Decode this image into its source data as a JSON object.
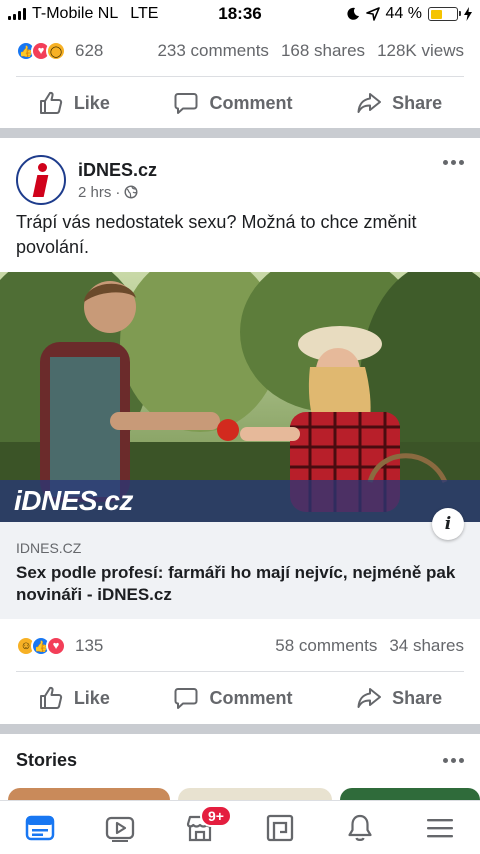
{
  "status_bar": {
    "carrier": "T-Mobile NL",
    "network": "LTE",
    "time": "18:36",
    "battery": "44 %",
    "battery_level": 0.44
  },
  "prev_post": {
    "reaction_count": "628",
    "comments": "233 comments",
    "shares": "168 shares",
    "views": "128K views",
    "reactions": [
      "like",
      "love",
      "wow"
    ]
  },
  "actions": {
    "like": "Like",
    "comment": "Comment",
    "share": "Share"
  },
  "post": {
    "page_name": "iDNES.cz",
    "time": "2 hrs",
    "text": "Trápí vás nedostatek sexu? Možná to chce změnit povolání.",
    "image_logo": "iDNES.cz",
    "link_domain": "IDNES.CZ",
    "link_title": "Sex podle profesí: farmáři ho mají nejvíc, nejméně pak novináři - iDNES.cz",
    "info_icon": "i",
    "reaction_count": "135",
    "comments": "58 comments",
    "shares": "34 shares",
    "reactions": [
      "haha",
      "like",
      "love"
    ]
  },
  "stories": {
    "title": "Stories"
  },
  "bottom_nav": {
    "items": [
      "news-feed-icon",
      "watch-icon",
      "marketplace-icon",
      "pages-icon",
      "notifications-icon",
      "menu-icon"
    ],
    "marketplace_badge": "9+"
  },
  "colors": {
    "brand_blue": "#1877f2",
    "secondary_text": "#65676b",
    "badge_red": "#e41e3f"
  }
}
